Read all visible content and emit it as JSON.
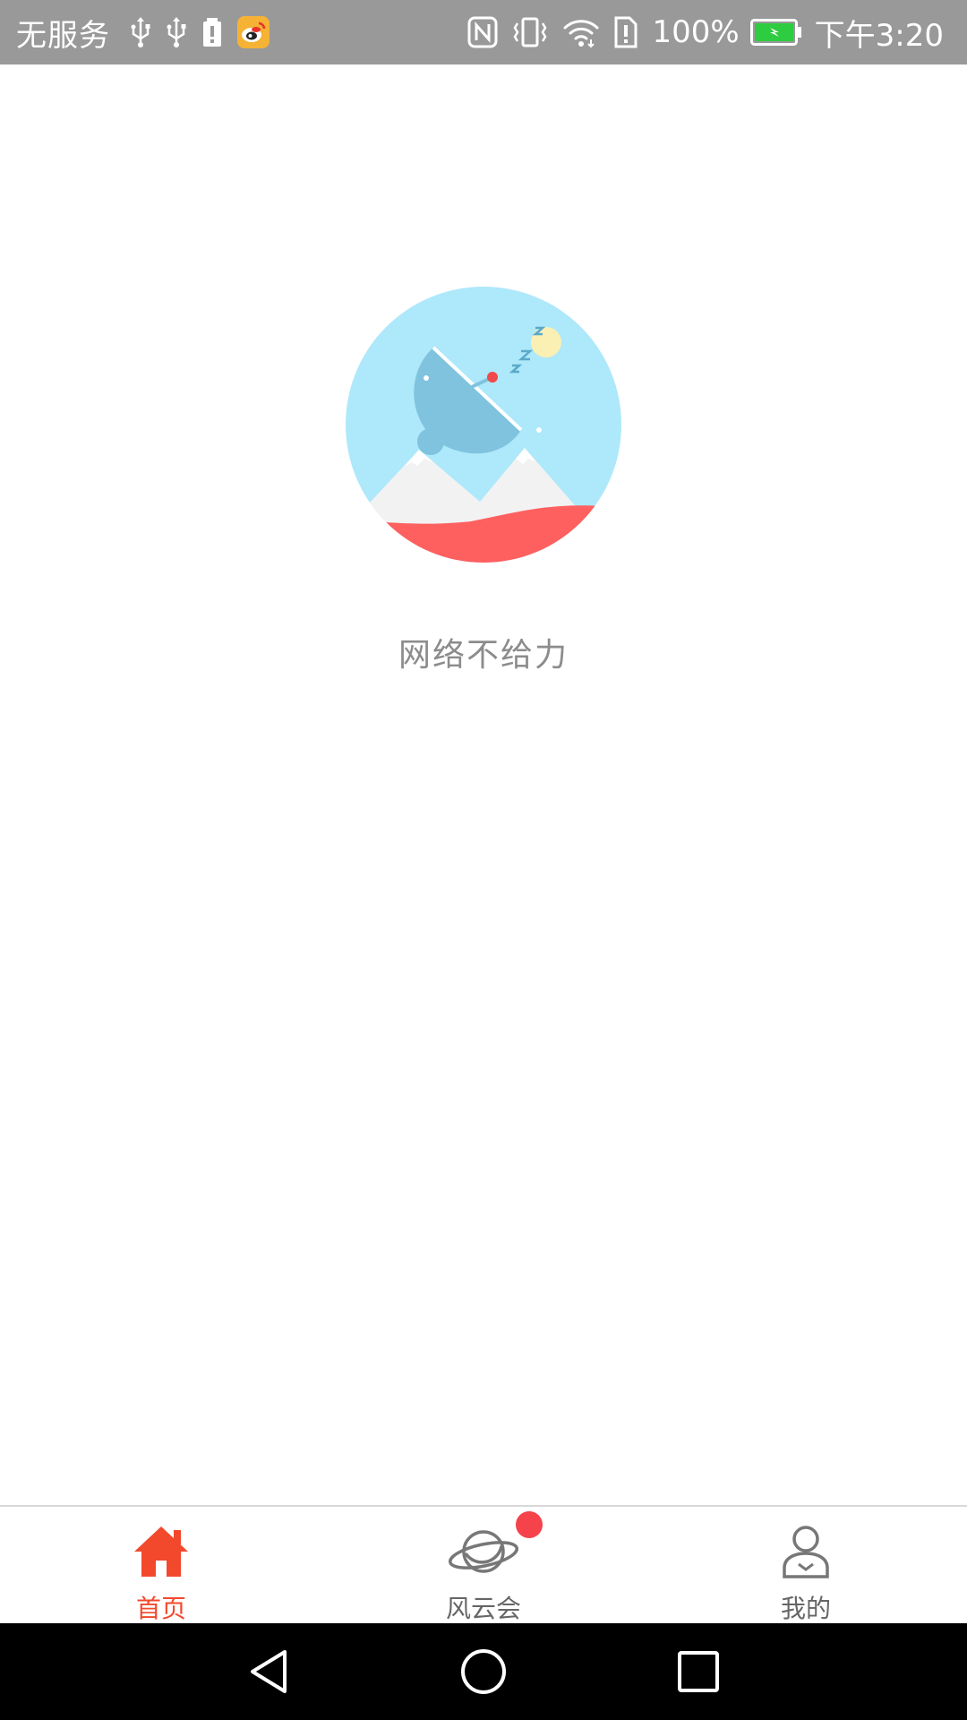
{
  "status_bar": {
    "carrier": "无服务",
    "battery_percent": "100%",
    "time": "下午3:20",
    "icons": [
      "usb-icon",
      "usb-icon",
      "battery-alert-icon",
      "weibo-icon",
      "nfc-icon",
      "vibrate-icon",
      "wifi-icon",
      "sim-alert-icon",
      "battery-charging-icon"
    ]
  },
  "main": {
    "illustration": "satellite-dish-sleeping-icon",
    "message": "网络不给力"
  },
  "tabs": [
    {
      "label": "首页",
      "icon": "home-icon",
      "active": true
    },
    {
      "label": "风云会",
      "icon": "planet-icon",
      "active": false,
      "badge": true
    },
    {
      "label": "我的",
      "icon": "user-icon",
      "active": false
    }
  ],
  "nav": {
    "buttons": [
      "back-icon",
      "home-circle-icon",
      "recents-icon"
    ]
  },
  "colors": {
    "accent": "#f2492d",
    "status_bar": "#999999",
    "badge": "#f5424b",
    "text_muted": "#8c8c8c"
  }
}
